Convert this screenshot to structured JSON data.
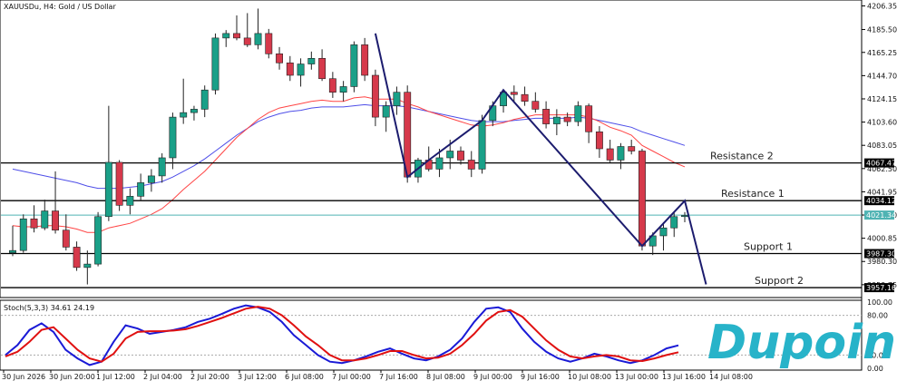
{
  "chart_data": [
    {
      "type": "candlestick",
      "title": "XAUUSDu, H4: Gold / US Dollar",
      "y_ticks": [
        "4206.35",
        "4185.50",
        "4165.25",
        "4144.70",
        "4124.15",
        "4103.60",
        "4083.05",
        "4062.50",
        "4041.95",
        "4021.40",
        "4000.85",
        "3980.30",
        "3959.75"
      ],
      "ylim": [
        3950,
        4210
      ],
      "x_ticks": [
        "30 Jun 2026",
        "30 Jun 20:00",
        "1 Jul 12:00",
        "2 Jul 04:00",
        "2 Jul 20:00",
        "3 Jul 12:00",
        "6 Jul 08:00",
        "7 Jul 00:00",
        "7 Jul 16:00",
        "8 Jul 08:00",
        "9 Jul 00:00",
        "9 Jul 16:00",
        "10 Jul 08:00",
        "13 Jul 00:00",
        "13 Jul 16:00",
        "14 Jul 08:00"
      ],
      "candles": [
        {
          "o": 3988,
          "h": 4012,
          "l": 3985,
          "c": 3990
        },
        {
          "o": 3990,
          "h": 4022,
          "l": 3988,
          "c": 4018
        },
        {
          "o": 4018,
          "h": 4030,
          "l": 4006,
          "c": 4010
        },
        {
          "o": 4010,
          "h": 4035,
          "l": 4008,
          "c": 4025
        },
        {
          "o": 4025,
          "h": 4060,
          "l": 4005,
          "c": 4008
        },
        {
          "o": 4008,
          "h": 4022,
          "l": 3990,
          "c": 3993
        },
        {
          "o": 3993,
          "h": 3998,
          "l": 3972,
          "c": 3975
        },
        {
          "o": 3975,
          "h": 3990,
          "l": 3960,
          "c": 3978
        },
        {
          "o": 3978,
          "h": 4024,
          "l": 3976,
          "c": 4020
        },
        {
          "o": 4020,
          "h": 4118,
          "l": 4016,
          "c": 4068
        },
        {
          "o": 4068,
          "h": 4070,
          "l": 4025,
          "c": 4030
        },
        {
          "o": 4030,
          "h": 4045,
          "l": 4022,
          "c": 4038
        },
        {
          "o": 4038,
          "h": 4058,
          "l": 4034,
          "c": 4050
        },
        {
          "o": 4050,
          "h": 4062,
          "l": 4042,
          "c": 4056
        },
        {
          "o": 4056,
          "h": 4076,
          "l": 4050,
          "c": 4072
        },
        {
          "o": 4072,
          "h": 4112,
          "l": 4062,
          "c": 4108
        },
        {
          "o": 4108,
          "h": 4142,
          "l": 4102,
          "c": 4112
        },
        {
          "o": 4112,
          "h": 4118,
          "l": 4105,
          "c": 4115
        },
        {
          "o": 4115,
          "h": 4136,
          "l": 4108,
          "c": 4132
        },
        {
          "o": 4132,
          "h": 4182,
          "l": 4128,
          "c": 4178
        },
        {
          "o": 4178,
          "h": 4185,
          "l": 4170,
          "c": 4182
        },
        {
          "o": 4182,
          "h": 4198,
          "l": 4176,
          "c": 4178
        },
        {
          "o": 4178,
          "h": 4200,
          "l": 4170,
          "c": 4172
        },
        {
          "o": 4172,
          "h": 4204,
          "l": 4168,
          "c": 4182
        },
        {
          "o": 4182,
          "h": 4186,
          "l": 4160,
          "c": 4164
        },
        {
          "o": 4164,
          "h": 4170,
          "l": 4150,
          "c": 4156
        },
        {
          "o": 4156,
          "h": 4162,
          "l": 4140,
          "c": 4145
        },
        {
          "o": 4145,
          "h": 4160,
          "l": 4135,
          "c": 4155
        },
        {
          "o": 4155,
          "h": 4166,
          "l": 4150,
          "c": 4160
        },
        {
          "o": 4160,
          "h": 4168,
          "l": 4140,
          "c": 4142
        },
        {
          "o": 4142,
          "h": 4148,
          "l": 4125,
          "c": 4130
        },
        {
          "o": 4130,
          "h": 4140,
          "l": 4122,
          "c": 4135
        },
        {
          "o": 4135,
          "h": 4175,
          "l": 4130,
          "c": 4172
        },
        {
          "o": 4172,
          "h": 4178,
          "l": 4140,
          "c": 4145
        },
        {
          "o": 4145,
          "h": 4150,
          "l": 4100,
          "c": 4108
        },
        {
          "o": 4108,
          "h": 4122,
          "l": 4095,
          "c": 4118
        },
        {
          "o": 4118,
          "h": 4135,
          "l": 4110,
          "c": 4130
        },
        {
          "o": 4130,
          "h": 4136,
          "l": 4050,
          "c": 4055
        },
        {
          "o": 4055,
          "h": 4072,
          "l": 4050,
          "c": 4070
        },
        {
          "o": 4070,
          "h": 4082,
          "l": 4060,
          "c": 4062
        },
        {
          "o": 4062,
          "h": 4080,
          "l": 4055,
          "c": 4072
        },
        {
          "o": 4072,
          "h": 4088,
          "l": 4062,
          "c": 4078
        },
        {
          "o": 4078,
          "h": 4082,
          "l": 4066,
          "c": 4070
        },
        {
          "o": 4070,
          "h": 4078,
          "l": 4055,
          "c": 4062
        },
        {
          "o": 4062,
          "h": 4110,
          "l": 4058,
          "c": 4105
        },
        {
          "o": 4105,
          "h": 4122,
          "l": 4100,
          "c": 4118
        },
        {
          "o": 4118,
          "h": 4132,
          "l": 4112,
          "c": 4130
        },
        {
          "o": 4130,
          "h": 4136,
          "l": 4122,
          "c": 4128
        },
        {
          "o": 4128,
          "h": 4135,
          "l": 4118,
          "c": 4122
        },
        {
          "o": 4122,
          "h": 4130,
          "l": 4112,
          "c": 4115
        },
        {
          "o": 4115,
          "h": 4122,
          "l": 4098,
          "c": 4102
        },
        {
          "o": 4102,
          "h": 4115,
          "l": 4092,
          "c": 4108
        },
        {
          "o": 4108,
          "h": 4112,
          "l": 4100,
          "c": 4104
        },
        {
          "o": 4104,
          "h": 4122,
          "l": 4100,
          "c": 4118
        },
        {
          "o": 4118,
          "h": 4120,
          "l": 4085,
          "c": 4095
        },
        {
          "o": 4095,
          "h": 4100,
          "l": 4072,
          "c": 4080
        },
        {
          "o": 4080,
          "h": 4088,
          "l": 4068,
          "c": 4070
        },
        {
          "o": 4070,
          "h": 4085,
          "l": 4062,
          "c": 4082
        },
        {
          "o": 4082,
          "h": 4088,
          "l": 4075,
          "c": 4078
        },
        {
          "o": 4078,
          "h": 4080,
          "l": 3990,
          "c": 3994
        },
        {
          "o": 3994,
          "h": 4006,
          "l": 3986,
          "c": 4003
        },
        {
          "o": 4003,
          "h": 4015,
          "l": 3990,
          "c": 4010
        },
        {
          "o": 4010,
          "h": 4024,
          "l": 4002,
          "c": 4020
        },
        {
          "o": 4020,
          "h": 4024,
          "l": 4015,
          "c": 4021
        }
      ],
      "ma_fast": [
        4012,
        4011,
        4011,
        4012,
        4012,
        4011,
        4009,
        4006,
        4006,
        4010,
        4012,
        4014,
        4018,
        4022,
        4027,
        4035,
        4044,
        4052,
        4060,
        4070,
        4080,
        4090,
        4098,
        4106,
        4112,
        4116,
        4118,
        4120,
        4122,
        4123,
        4122,
        4122,
        4125,
        4126,
        4124,
        4124,
        4124,
        4120,
        4117,
        4113,
        4110,
        4107,
        4104,
        4101,
        4100,
        4101,
        4103,
        4106,
        4108,
        4110,
        4110,
        4110,
        4110,
        4110,
        4108,
        4104,
        4099,
        4096,
        4092,
        4083,
        4078,
        4073,
        4068,
        4064
      ],
      "ma_slow": [
        4062,
        4060,
        4058,
        4056,
        4054,
        4052,
        4050,
        4047,
        4045,
        4045,
        4045,
        4046,
        4047,
        4049,
        4051,
        4055,
        4060,
        4065,
        4071,
        4078,
        4085,
        4092,
        4098,
        4104,
        4108,
        4111,
        4113,
        4114,
        4116,
        4117,
        4117,
        4117,
        4118,
        4119,
        4118,
        4118,
        4118,
        4117,
        4115,
        4113,
        4111,
        4109,
        4107,
        4105,
        4104,
        4104,
        4104,
        4105,
        4106,
        4107,
        4107,
        4107,
        4107,
        4108,
        4107,
        4105,
        4103,
        4101,
        4099,
        4095,
        4092,
        4089,
        4086,
        4083
      ],
      "zigzag": [
        [
          34,
          4182
        ],
        [
          37,
          4055
        ],
        [
          39,
          4070
        ],
        [
          44,
          4105
        ],
        [
          46,
          4132
        ],
        [
          59,
          3994
        ],
        [
          63,
          4034
        ],
        [
          65,
          3960
        ]
      ],
      "levels": [
        {
          "value": 4067.47,
          "label": "Resistance 2",
          "tag": "4067.47"
        },
        {
          "value": 4034.12,
          "label": "Resistance 1",
          "tag": "4034.12"
        },
        {
          "value": 3987.3,
          "label": "Support 1",
          "tag": "3987.30"
        },
        {
          "value": 3957.16,
          "label": "Support 2",
          "tag": "3957.16"
        }
      ],
      "current_price": {
        "value": 4021.34,
        "tag": "4021.34"
      }
    },
    {
      "type": "line",
      "title": "Stoch(5,3,3) 34.61 24.19",
      "y_ticks": [
        "100.00",
        "80.00",
        "20.00",
        "0.00"
      ],
      "ylim": [
        0,
        100
      ],
      "levels": [
        80,
        20
      ],
      "series": [
        {
          "color": "#1a1ad6",
          "values": [
            20,
            35,
            58,
            68,
            55,
            28,
            15,
            5,
            10,
            40,
            65,
            60,
            52,
            55,
            58,
            62,
            70,
            75,
            82,
            90,
            95,
            92,
            85,
            70,
            50,
            35,
            20,
            10,
            8,
            12,
            18,
            25,
            30,
            22,
            15,
            12,
            18,
            28,
            45,
            70,
            90,
            92,
            85,
            60,
            40,
            25,
            15,
            10,
            15,
            22,
            18,
            12,
            8,
            12,
            20,
            30,
            34.61
          ]
        },
        {
          "color": "#e01010",
          "values": [
            18,
            25,
            40,
            58,
            62,
            45,
            28,
            15,
            10,
            22,
            45,
            55,
            56,
            56,
            57,
            59,
            64,
            70,
            76,
            83,
            90,
            93,
            90,
            80,
            65,
            48,
            35,
            20,
            12,
            12,
            15,
            20,
            26,
            26,
            20,
            15,
            16,
            22,
            35,
            52,
            72,
            85,
            88,
            78,
            60,
            42,
            28,
            18,
            15,
            18,
            20,
            18,
            12,
            11,
            15,
            20,
            24.19
          ]
        }
      ]
    }
  ],
  "logo": {
    "text": "Dupoin",
    "color": "#27b3c9"
  },
  "colors": {
    "bull": "#1aa088",
    "bear": "#d6394b",
    "ma_fast": "#ff4444",
    "ma_slow": "#4e4ee8",
    "zigzag": "#1c1c6e",
    "price_line": "#4fb3b3"
  }
}
